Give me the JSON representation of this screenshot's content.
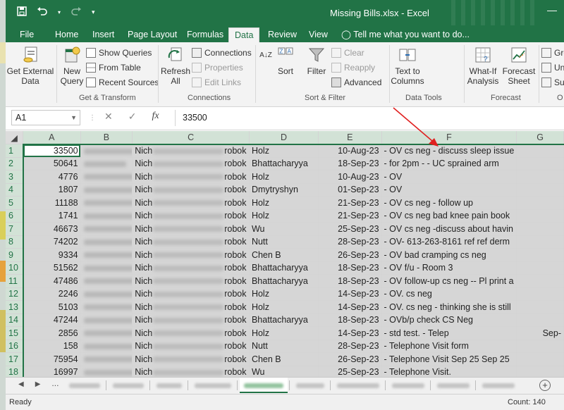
{
  "window": {
    "title": "Missing Bills.xlsx - Excel"
  },
  "quick_access": {
    "save_icon": "save-icon",
    "undo_icon": "undo-icon",
    "redo_icon": "redo-icon",
    "customize_icon": "customize-icon"
  },
  "tabs": [
    "File",
    "Home",
    "Insert",
    "Page Layout",
    "Formulas",
    "Data",
    "Review",
    "View"
  ],
  "active_tab": "Data",
  "tell_me": "Tell me what you want to do...",
  "ribbon": {
    "get_external_data": "Get External Data",
    "new_query": "New Query",
    "show_queries": "Show Queries",
    "from_table": "From Table",
    "recent_sources": "Recent Sources",
    "get_transform": "Get & Transform",
    "refresh_all": "Refresh All",
    "connections": "Connections",
    "properties": "Properties",
    "edit_links": "Edit Links",
    "connections_group": "Connections",
    "sort_az": "A↓Z",
    "sort": "Sort",
    "filter": "Filter",
    "clear": "Clear",
    "reapply": "Reapply",
    "advanced": "Advanced",
    "sort_filter_group": "Sort & Filter",
    "text_to_columns": "Text to Columns",
    "data_tools_group": "Data Tools",
    "what_if": "What-If Analysis",
    "forecast_sheet": "Forecast Sheet",
    "forecast_group": "Forecast",
    "group": "Gro",
    "ungroup": "Ung",
    "subtotal": "Sub",
    "outline_group": "O"
  },
  "formula_bar": {
    "name_box": "A1",
    "cancel": "✕",
    "enter": "✓",
    "fx": "fx",
    "formula": "33500"
  },
  "columns": [
    "A",
    "B",
    "C",
    "D",
    "E",
    "F",
    "G"
  ],
  "rows": [
    {
      "n": "1",
      "a": "33500",
      "c1": "Nich",
      "c2": "robok",
      "d": "Holz",
      "e": "10-Aug-23",
      "f": "- OV  cs neg  - discuss sleep  issue"
    },
    {
      "n": "2",
      "a": "50641",
      "c1": "Nich",
      "c2": "robok",
      "d": "Bhattacharyya",
      "e": "18-Sep-23",
      "f": "- for 2pm - - UC sprained arm"
    },
    {
      "n": "3",
      "a": "4776",
      "c1": "Nich",
      "c2": "robok",
      "d": "Holz",
      "e": "10-Aug-23",
      "f": "- OV"
    },
    {
      "n": "4",
      "a": "1807",
      "c1": "Nich",
      "c2": "robok",
      "d": "Dmytryshyn",
      "e": "01-Sep-23",
      "f": "- OV"
    },
    {
      "n": "5",
      "a": "11188",
      "c1": "Nich",
      "c2": "robok",
      "d": "Holz",
      "e": "21-Sep-23",
      "f": "- OV  cs neg  - follow up"
    },
    {
      "n": "6",
      "a": "1741",
      "c1": "Nich",
      "c2": "robok",
      "d": "Holz",
      "e": "21-Sep-23",
      "f": "- OV  cs neg  bad knee pain  book"
    },
    {
      "n": "7",
      "a": "46673",
      "c1": "Nich",
      "c2": "robok",
      "d": "Wu",
      "e": "25-Sep-23",
      "f": "- OV  cs neg  -discuss about havin"
    },
    {
      "n": "8",
      "a": "74202",
      "c1": "Nich",
      "c2": "robok",
      "d": "Nutt",
      "e": "28-Sep-23",
      "f": "- OV- 613-263-8161 ref ref derm"
    },
    {
      "n": "9",
      "a": "9334",
      "c1": "Nich",
      "c2": "robok",
      "d": "Chen B",
      "e": "26-Sep-23",
      "f": "- OV bad cramping cs  neg"
    },
    {
      "n": "10",
      "a": "51562",
      "c1": "Nich",
      "c2": "robok",
      "d": "Bhattacharyya",
      "e": "18-Sep-23",
      "f": "- OV f/u - Room 3"
    },
    {
      "n": "11",
      "a": "47486",
      "c1": "Nich",
      "c2": "robok",
      "d": "Bhattacharyya",
      "e": "18-Sep-23",
      "f": "- OV follow-up cs neg --  Pl print a"
    },
    {
      "n": "12",
      "a": "2246",
      "c1": "Nich",
      "c2": "robok",
      "d": "Holz",
      "e": "14-Sep-23",
      "f": "- OV.  cs neg"
    },
    {
      "n": "13",
      "a": "5103",
      "c1": "Nich",
      "c2": "robok",
      "d": "Holz",
      "e": "14-Sep-23",
      "f": "- OV.  cs neg - thinking she is still"
    },
    {
      "n": "14",
      "a": "47244",
      "c1": "Nich",
      "c2": "robok",
      "d": "Bhattacharyya",
      "e": "18-Sep-23",
      "f": "- OVb/p check CS Neg"
    },
    {
      "n": "15",
      "a": "2856",
      "c1": "Nich",
      "c2": "robok",
      "d": "Holz",
      "e": "14-Sep-23",
      "f": "- std test. - Telep",
      "g": "Sep-"
    },
    {
      "n": "16",
      "a": "158",
      "c1": "Nich",
      "c2": "robok",
      "d": "Nutt",
      "e": "28-Sep-23",
      "f": "- Telephone Visit   form"
    },
    {
      "n": "17",
      "a": "75954",
      "c1": "Nich",
      "c2": "robok",
      "d": "Chen B",
      "e": "26-Sep-23",
      "f": "- Telephone Visit  Sep 25  Sep 25"
    },
    {
      "n": "18",
      "a": "16997",
      "c1": "Nich",
      "c2": "robok",
      "d": "Wu",
      "e": "25-Sep-23",
      "f": "- Telephone Visit."
    }
  ],
  "sheet_nav": {
    "prev": "◀",
    "next": "▶",
    "more": "..."
  },
  "status": {
    "ready": "Ready",
    "count": "Count: 140"
  },
  "colors": {
    "excel_green": "#217346",
    "arrow_red": "#e02020"
  }
}
